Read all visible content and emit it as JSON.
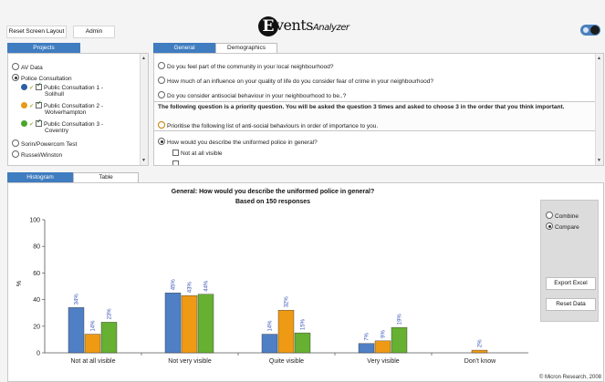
{
  "toolbar": {
    "reset_layout_label": "Reset Screen Layout",
    "admin_label": "Admin"
  },
  "logo": {
    "initial": "E",
    "text": "vents",
    "suffix": "Analyzer"
  },
  "projects": {
    "tab_label": "Projects",
    "items": [
      {
        "label": "AV Data",
        "selected": false
      },
      {
        "label": "Police Consultation",
        "selected": true
      },
      {
        "label1": "Public Consultation 1 -",
        "label2": "Solihull",
        "color": "#2b5fa5"
      },
      {
        "label1": "Public Consultation 2 -",
        "label2": "Wolverhampton",
        "color": "#e69a1b"
      },
      {
        "label1": "Public Consultation 3 -",
        "label2": "Coventry",
        "color": "#4aa52b"
      },
      {
        "label": "Sorin/Powercom Test",
        "selected": false
      },
      {
        "label": "Russel/Winston",
        "selected": false
      }
    ]
  },
  "question_tabs": {
    "general": "General",
    "demographics": "Demographics"
  },
  "questions": {
    "q1": "Do you feel part of the community in your local neighbourhood?",
    "q2": "How much of an influence on your quality of life do you consider fear of crime in your neighbourhood?",
    "q3": "Do you consider antisocial behaviour in your neighbourhood to be..?",
    "priority_heading": "The following question is a priority question. You will be asked the question 3 times and asked to choose 3 in the order that you think important.",
    "priority_item": "Prioritise the following list of anti-social behaviours in order of importance to you.",
    "q4": "How would you describe the uniformed police in general?",
    "q4_option": "Not at all visible"
  },
  "bottom_tabs": {
    "histogram": "Histogram",
    "table": "Table"
  },
  "chart_data": {
    "type": "bar",
    "title": "General: How would you describe the uniformed police in general?",
    "subtitle": "Based on 150 responses",
    "ylabel": "%",
    "ylim": [
      0,
      100
    ],
    "yticks": [
      0,
      20,
      40,
      60,
      80,
      100
    ],
    "categories": [
      "Not at all visible",
      "Not very visible",
      "Quite visible",
      "Very visible",
      "Don't know"
    ],
    "series": [
      {
        "color": "#4f7fc4",
        "values": [
          34,
          45,
          14,
          7,
          0
        ],
        "labels": [
          "34%",
          "45%",
          "14%",
          "7%",
          ""
        ]
      },
      {
        "color": "#ef9a14",
        "values": [
          14,
          43,
          32,
          9,
          2
        ],
        "labels": [
          "14%",
          "43%",
          "32%",
          "9%",
          "2%"
        ]
      },
      {
        "color": "#66b032",
        "values": [
          23,
          44,
          15,
          19,
          0
        ],
        "labels": [
          "23%",
          "44%",
          "15%",
          "19%",
          ""
        ]
      }
    ]
  },
  "side_panel": {
    "combine_label": "Combine",
    "compare_label": "Compare",
    "export_label": "Export Excel",
    "reset_label": "Reset Data"
  },
  "footer": {
    "copyright": "© Micron Research, 2008"
  }
}
